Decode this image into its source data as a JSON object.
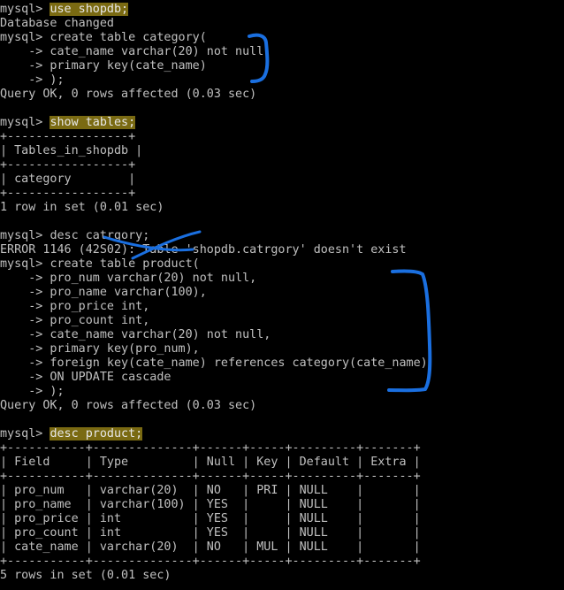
{
  "terminal": {
    "lines": [
      {
        "prompt": "mysql> ",
        "cmd": "use shopdb;",
        "highlight": true
      },
      {
        "text": "Database changed"
      },
      {
        "prompt": "mysql> ",
        "cmd": "create table category("
      },
      {
        "text": "    -> cate_name varchar(20) not null,"
      },
      {
        "text": "    -> primary key(cate_name)"
      },
      {
        "text": "    -> );"
      },
      {
        "text": "Query OK, 0 rows affected (0.03 sec)"
      },
      {
        "text": ""
      },
      {
        "prompt": "mysql> ",
        "cmd": "show tables;",
        "highlight": true
      },
      {
        "text": "+-----------------+"
      },
      {
        "text": "| Tables_in_shopdb |"
      },
      {
        "text": "+-----------------+"
      },
      {
        "text": "| category        |"
      },
      {
        "text": "+-----------------+"
      },
      {
        "text": "1 row in set (0.01 sec)"
      },
      {
        "text": ""
      },
      {
        "prompt": "mysql> ",
        "cmd": "desc catrgory;"
      },
      {
        "text": "ERROR 1146 (42S02): Table 'shopdb.catrgory' doesn't exist"
      },
      {
        "prompt": "mysql> ",
        "cmd": "create table product("
      },
      {
        "text": "    -> pro_num varchar(20) not null,"
      },
      {
        "text": "    -> pro_name varchar(100),"
      },
      {
        "text": "    -> pro_price int,"
      },
      {
        "text": "    -> pro_count int,"
      },
      {
        "text": "    -> cate_name varchar(20) not null,"
      },
      {
        "text": "    -> primary key(pro_num),"
      },
      {
        "text": "    -> foreign key(cate_name) references category(cate_name)"
      },
      {
        "text": "    -> ON UPDATE cascade"
      },
      {
        "text": "    -> );"
      },
      {
        "text": "Query OK, 0 rows affected (0.03 sec)"
      },
      {
        "text": ""
      },
      {
        "prompt": "mysql> ",
        "cmd": "desc product;",
        "highlight": true
      },
      {
        "text": "+-----------+--------------+------+-----+---------+-------+"
      },
      {
        "text": "| Field     | Type         | Null | Key | Default | Extra |"
      },
      {
        "text": "+-----------+--------------+------+-----+---------+-------+"
      },
      {
        "text": "| pro_num   | varchar(20)  | NO   | PRI | NULL    |       |"
      },
      {
        "text": "| pro_name  | varchar(100) | YES  |     | NULL    |       |"
      },
      {
        "text": "| pro_price | int          | YES  |     | NULL    |       |"
      },
      {
        "text": "| pro_count | int          | YES  |     | NULL    |       |"
      },
      {
        "text": "| cate_name | varchar(20)  | NO   | MUL | NULL    |       |"
      },
      {
        "text": "+-----------+--------------+------+-----+---------+-------+"
      },
      {
        "text": "5 rows in set (0.01 sec)"
      }
    ]
  },
  "colors": {
    "background": "#000000",
    "text": "#c0c0c0",
    "highlight": "#7a6a12",
    "annotation": "#1a6fe0"
  }
}
